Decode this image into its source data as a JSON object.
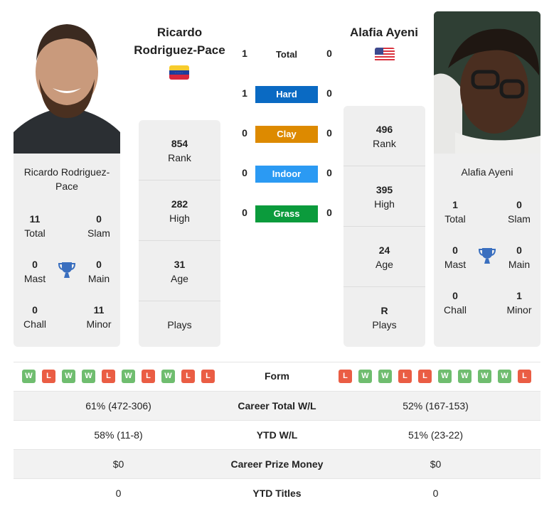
{
  "player1": {
    "name_line1": "Ricardo",
    "name_line2": "Rodriguez-Pace",
    "card_name": "Ricardo Rodriguez-Pace",
    "flag": "venezuela-flag",
    "titles": {
      "total": {
        "value": "11",
        "label": "Total"
      },
      "slam": {
        "value": "0",
        "label": "Slam"
      },
      "mast": {
        "value": "0",
        "label": "Mast"
      },
      "main": {
        "value": "0",
        "label": "Main"
      },
      "chall": {
        "value": "0",
        "label": "Chall"
      },
      "minor": {
        "value": "11",
        "label": "Minor"
      }
    },
    "rank": {
      "value": "854",
      "label": "Rank"
    },
    "high": {
      "value": "282",
      "label": "High"
    },
    "age": {
      "value": "31",
      "label": "Age"
    },
    "plays": {
      "value": "",
      "label": "Plays"
    },
    "form": [
      "W",
      "L",
      "W",
      "W",
      "L",
      "W",
      "L",
      "W",
      "L",
      "L"
    ]
  },
  "player2": {
    "name": "Alafia Ayeni",
    "card_name": "Alafia Ayeni",
    "flag": "usa-flag",
    "titles": {
      "total": {
        "value": "1",
        "label": "Total"
      },
      "slam": {
        "value": "0",
        "label": "Slam"
      },
      "mast": {
        "value": "0",
        "label": "Mast"
      },
      "main": {
        "value": "0",
        "label": "Main"
      },
      "chall": {
        "value": "0",
        "label": "Chall"
      },
      "minor": {
        "value": "1",
        "label": "Minor"
      }
    },
    "rank": {
      "value": "496",
      "label": "Rank"
    },
    "high": {
      "value": "395",
      "label": "High"
    },
    "age": {
      "value": "24",
      "label": "Age"
    },
    "plays": {
      "value": "R",
      "label": "Plays"
    },
    "form": [
      "L",
      "W",
      "W",
      "L",
      "L",
      "W",
      "W",
      "W",
      "W",
      "L"
    ]
  },
  "h2h": {
    "total": {
      "label": "Total",
      "p1": "1",
      "p2": "0"
    },
    "surfaces": [
      {
        "label": "Hard",
        "p1": "1",
        "p2": "0",
        "color": "#0a6ac3"
      },
      {
        "label": "Clay",
        "p1": "0",
        "p2": "0",
        "color": "#dd8a00"
      },
      {
        "label": "Indoor",
        "p1": "0",
        "p2": "0",
        "color": "#2b9af3"
      },
      {
        "label": "Grass",
        "p1": "0",
        "p2": "0",
        "color": "#0b9b3c"
      }
    ]
  },
  "form_label": "Form",
  "stats": [
    {
      "label": "Career Total W/L",
      "p1": "61% (472-306)",
      "p2": "52% (167-153)"
    },
    {
      "label": "YTD W/L",
      "p1": "58% (11-8)",
      "p2": "51% (23-22)"
    },
    {
      "label": "Career Prize Money",
      "p1": "$0",
      "p2": "$0"
    },
    {
      "label": "YTD Titles",
      "p1": "0",
      "p2": "0"
    }
  ],
  "colors": {
    "win": "#6fbd6f",
    "loss": "#ea5d44",
    "trophy": "#3a6fbf"
  }
}
